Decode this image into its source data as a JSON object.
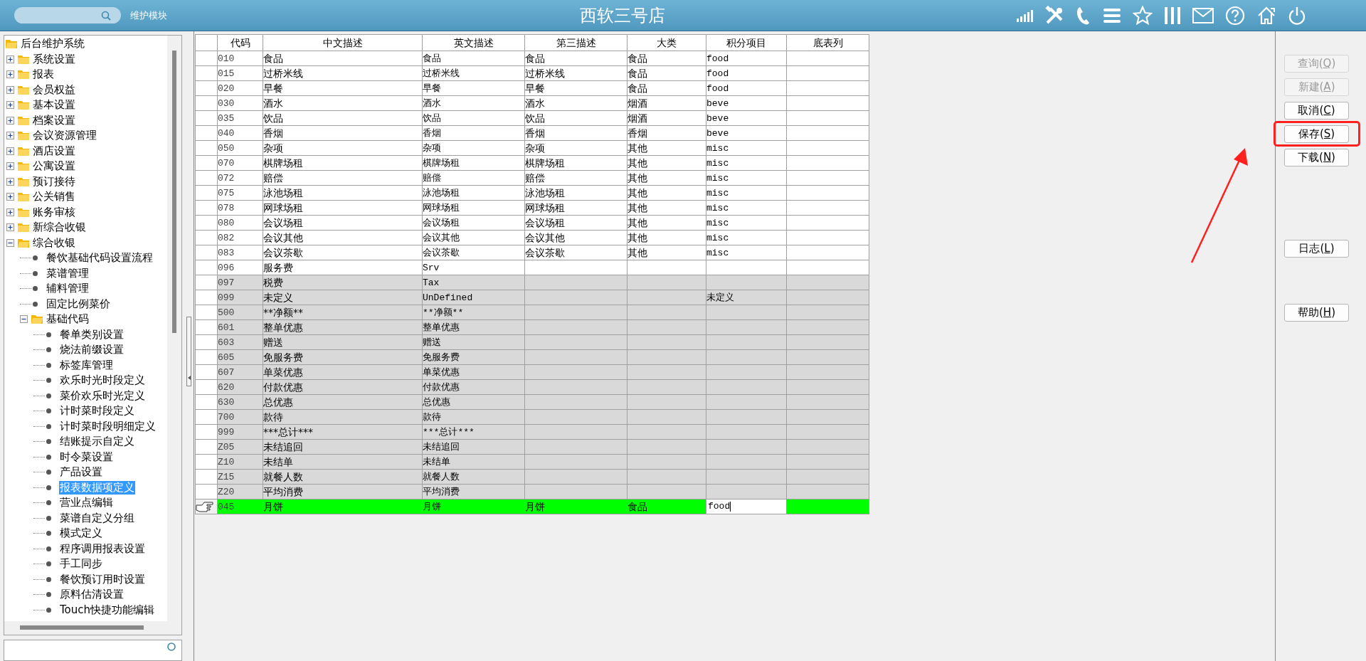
{
  "header": {
    "module_label": "维护模块",
    "title": "西软三号店"
  },
  "tree": {
    "label": "后台维护系统",
    "kind": "folder",
    "expanded": true,
    "selected": false,
    "children": [
      {
        "label": "系统设置",
        "kind": "folder",
        "expanded": false,
        "selected": false
      },
      {
        "label": "报表",
        "kind": "folder",
        "expanded": false,
        "selected": false
      },
      {
        "label": "会员权益",
        "kind": "folder",
        "expanded": false,
        "selected": false
      },
      {
        "label": "基本设置",
        "kind": "folder",
        "expanded": false,
        "selected": false
      },
      {
        "label": "档案设置",
        "kind": "folder",
        "expanded": false,
        "selected": false
      },
      {
        "label": "会议资源管理",
        "kind": "folder",
        "expanded": false,
        "selected": false
      },
      {
        "label": "酒店设置",
        "kind": "folder",
        "expanded": false,
        "selected": false
      },
      {
        "label": "公寓设置",
        "kind": "folder",
        "expanded": false,
        "selected": false
      },
      {
        "label": "预订接待",
        "kind": "folder",
        "expanded": false,
        "selected": false
      },
      {
        "label": "公关销售",
        "kind": "folder",
        "expanded": false,
        "selected": false
      },
      {
        "label": "账务审核",
        "kind": "folder",
        "expanded": false,
        "selected": false
      },
      {
        "label": "新综合收银",
        "kind": "folder",
        "expanded": false,
        "selected": false
      },
      {
        "label": "综合收银",
        "kind": "folder",
        "expanded": true,
        "selected": false,
        "children": [
          {
            "label": "餐饮基础代码设置流程",
            "kind": "leaf",
            "selected": false
          },
          {
            "label": "菜谱管理",
            "kind": "leaf",
            "selected": false
          },
          {
            "label": "辅料管理",
            "kind": "leaf",
            "selected": false
          },
          {
            "label": "固定比例菜价",
            "kind": "leaf",
            "selected": false
          },
          {
            "label": "基础代码",
            "kind": "folder",
            "expanded": true,
            "selected": false,
            "children": [
              {
                "label": "餐单类别设置",
                "kind": "leaf",
                "selected": false
              },
              {
                "label": "烧法前缀设置",
                "kind": "leaf",
                "selected": false
              },
              {
                "label": "标签库管理",
                "kind": "leaf",
                "selected": false
              },
              {
                "label": "欢乐时光时段定义",
                "kind": "leaf",
                "selected": false
              },
              {
                "label": "菜价欢乐时光定义",
                "kind": "leaf",
                "selected": false
              },
              {
                "label": "计时菜时段定义",
                "kind": "leaf",
                "selected": false
              },
              {
                "label": "计时菜时段明细定义",
                "kind": "leaf",
                "selected": false
              },
              {
                "label": "结账提示自定义",
                "kind": "leaf",
                "selected": false
              },
              {
                "label": "时令菜设置",
                "kind": "leaf",
                "selected": false
              },
              {
                "label": "产品设置",
                "kind": "leaf",
                "selected": false
              },
              {
                "label": "报表数据项定义",
                "kind": "leaf",
                "selected": true
              },
              {
                "label": "营业点编辑",
                "kind": "leaf",
                "selected": false
              },
              {
                "label": "菜谱自定义分组",
                "kind": "leaf",
                "selected": false
              },
              {
                "label": "模式定义",
                "kind": "leaf",
                "selected": false
              },
              {
                "label": "程序调用报表设置",
                "kind": "leaf",
                "selected": false
              },
              {
                "label": "手工同步",
                "kind": "leaf",
                "selected": false
              },
              {
                "label": "餐饮预订用时设置",
                "kind": "leaf",
                "selected": false
              },
              {
                "label": "原料估清设置",
                "kind": "leaf",
                "selected": false
              },
              {
                "label": "Touch快捷功能编辑",
                "kind": "leaf",
                "selected": false
              }
            ]
          }
        ]
      }
    ]
  },
  "table": {
    "columns": [
      "代码",
      "中文描述",
      "英文描述",
      "第三描述",
      "大类",
      "积分项目",
      "底表列"
    ],
    "rows": [
      {
        "code": "010",
        "chinese": "食品",
        "english": "食品",
        "third": "食品",
        "category": "食品",
        "points": "food",
        "shaded": false,
        "selected": false
      },
      {
        "code": "015",
        "chinese": "过桥米线",
        "english": "过桥米线",
        "third": "过桥米线",
        "category": "食品",
        "points": "food",
        "shaded": false,
        "selected": false
      },
      {
        "code": "020",
        "chinese": "早餐",
        "english": "早餐",
        "third": "早餐",
        "category": "食品",
        "points": "food",
        "shaded": false,
        "selected": false
      },
      {
        "code": "030",
        "chinese": "酒水",
        "english": "酒水",
        "third": "酒水",
        "category": "烟酒",
        "points": "beve",
        "shaded": false,
        "selected": false
      },
      {
        "code": "035",
        "chinese": "饮品",
        "english": "饮品",
        "third": "饮品",
        "category": "烟酒",
        "points": "beve",
        "shaded": false,
        "selected": false
      },
      {
        "code": "040",
        "chinese": "香烟",
        "english": "香烟",
        "third": "香烟",
        "category": "香烟",
        "points": "beve",
        "shaded": false,
        "selected": false
      },
      {
        "code": "050",
        "chinese": "杂项",
        "english": "杂项",
        "third": "杂项",
        "category": "其他",
        "points": "misc",
        "shaded": false,
        "selected": false
      },
      {
        "code": "070",
        "chinese": "棋牌场租",
        "english": "棋牌场租",
        "third": "棋牌场租",
        "category": "其他",
        "points": "misc",
        "shaded": false,
        "selected": false
      },
      {
        "code": "072",
        "chinese": "赔偿",
        "english": "赔偿",
        "third": "赔偿",
        "category": "其他",
        "points": "misc",
        "shaded": false,
        "selected": false
      },
      {
        "code": "075",
        "chinese": "泳池场租",
        "english": "泳池场租",
        "third": "泳池场租",
        "category": "其他",
        "points": "misc",
        "shaded": false,
        "selected": false
      },
      {
        "code": "078",
        "chinese": "网球场租",
        "english": "网球场租",
        "third": "网球场租",
        "category": "其他",
        "points": "misc",
        "shaded": false,
        "selected": false
      },
      {
        "code": "080",
        "chinese": "会议场租",
        "english": "会议场租",
        "third": "会议场租",
        "category": "其他",
        "points": "misc",
        "shaded": false,
        "selected": false
      },
      {
        "code": "082",
        "chinese": "会议其他",
        "english": "会议其他",
        "third": "会议其他",
        "category": "其他",
        "points": "misc",
        "shaded": false,
        "selected": false
      },
      {
        "code": "083",
        "chinese": "会议茶歇",
        "english": "会议茶歇",
        "third": "会议茶歇",
        "category": "其他",
        "points": "misc",
        "shaded": false,
        "selected": false
      },
      {
        "code": "096",
        "chinese": "服务费",
        "english": "Srv",
        "shaded": false,
        "selected": false
      },
      {
        "code": "097",
        "chinese": "税费",
        "english": "Tax",
        "shaded": true,
        "selected": false
      },
      {
        "code": "099",
        "chinese": "未定义",
        "english": "UnDefined",
        "points": "未定义",
        "shaded": true,
        "selected": false
      },
      {
        "code": "500",
        "chinese": "**净额**",
        "english": "**净额**",
        "shaded": true,
        "selected": false
      },
      {
        "code": "601",
        "chinese": "整单优惠",
        "english": "整单优惠",
        "shaded": true,
        "selected": false
      },
      {
        "code": "603",
        "chinese": "赠送",
        "english": "赠送",
        "shaded": true,
        "selected": false
      },
      {
        "code": "605",
        "chinese": "免服务费",
        "english": "免服务费",
        "shaded": true,
        "selected": false
      },
      {
        "code": "607",
        "chinese": "单菜优惠",
        "english": "单菜优惠",
        "shaded": true,
        "selected": false
      },
      {
        "code": "620",
        "chinese": "付款优惠",
        "english": "付款优惠",
        "shaded": true,
        "selected": false
      },
      {
        "code": "630",
        "chinese": "总优惠",
        "english": "总优惠",
        "shaded": true,
        "selected": false
      },
      {
        "code": "700",
        "chinese": "款待",
        "english": "款待",
        "shaded": true,
        "selected": false
      },
      {
        "code": "999",
        "chinese": "***总计***",
        "english": "***总计***",
        "shaded": true,
        "selected": false
      },
      {
        "code": "Z05",
        "chinese": "未结追回",
        "english": "未结追回",
        "shaded": true,
        "selected": false
      },
      {
        "code": "Z10",
        "chinese": "未结单",
        "english": "未结单",
        "shaded": true,
        "selected": false
      },
      {
        "code": "Z15",
        "chinese": "就餐人数",
        "english": "就餐人数",
        "shaded": true,
        "selected": false
      },
      {
        "code": "Z20",
        "chinese": "平均消费",
        "english": "平均消费",
        "shaded": true,
        "selected": false
      },
      {
        "code": "045",
        "chinese": "月饼",
        "english": "月饼",
        "third": "月饼",
        "category": "食品",
        "points": "food",
        "selected": true
      }
    ]
  },
  "button_groups": [
    [
      {
        "label": "查询(Q)",
        "disabled": true,
        "highlighted": false
      },
      {
        "label": "新建(A)",
        "disabled": true,
        "highlighted": false
      },
      {
        "label": "取消(C)",
        "disabled": false,
        "highlighted": false
      },
      {
        "label": "保存(S)",
        "disabled": false,
        "highlighted": true
      },
      {
        "label": "下载(N)",
        "disabled": false,
        "highlighted": false
      }
    ],
    [
      {
        "label": "日志(L)",
        "disabled": false,
        "highlighted": false
      }
    ],
    [
      {
        "label": "帮助(H)",
        "disabled": false,
        "highlighted": false
      }
    ]
  ]
}
